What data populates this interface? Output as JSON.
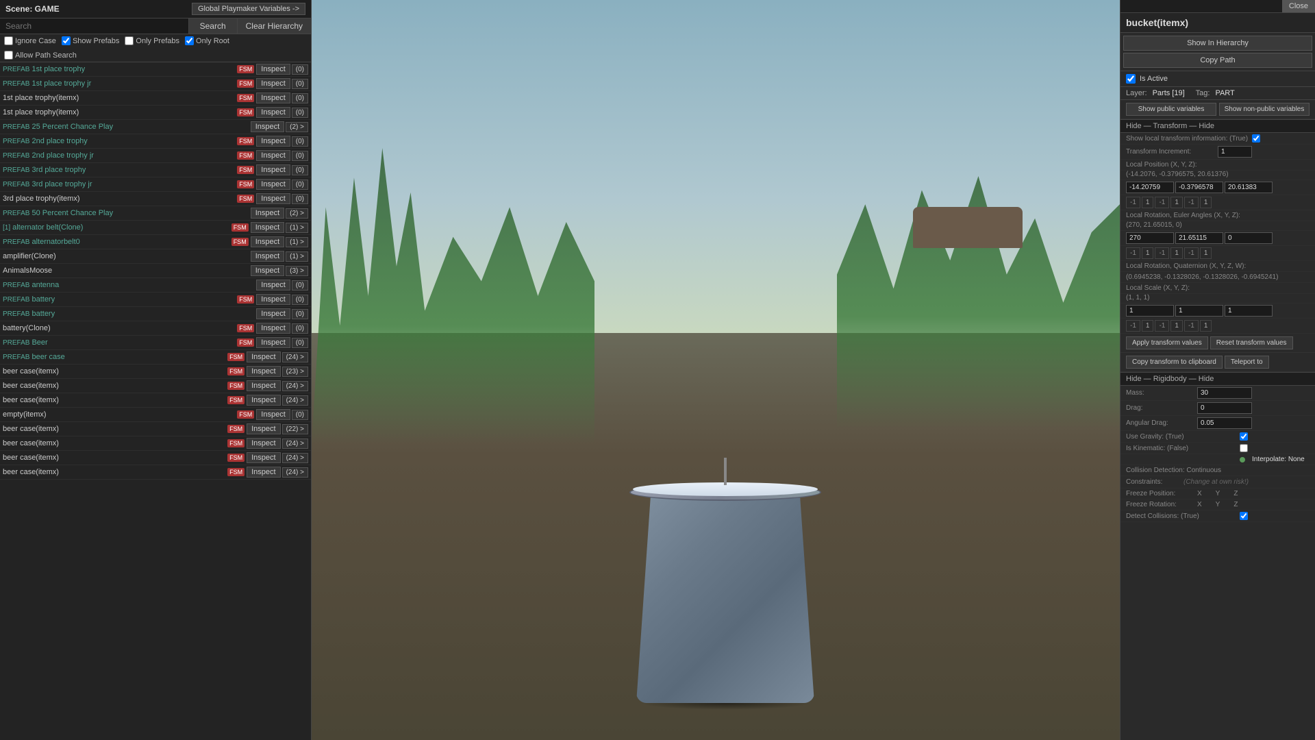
{
  "scene": {
    "title": "Scene: GAME",
    "global_playmaker_btn": "Global Playmaker Variables ->"
  },
  "search": {
    "placeholder": "Search",
    "search_label": "Search",
    "clear_label": "Clear Hierarchy"
  },
  "filters": {
    "ignore_case": "Ignore Case",
    "show_prefabs": "Show Prefabs",
    "only_prefabs": "Only Prefabs",
    "only_root": "Only Root",
    "allow_path_search": "Allow Path Search"
  },
  "hierarchy": [
    {
      "prefab": "PREFAB",
      "name": "1st place trophy",
      "fsm": true,
      "inspect": "Inspect",
      "count": "(0)"
    },
    {
      "prefab": "PREFAB",
      "name": "1st place trophy jr",
      "fsm": true,
      "inspect": "Inspect",
      "count": "(0)"
    },
    {
      "prefab": "",
      "name": "1st place trophy(itemx)",
      "fsm": true,
      "inspect": "Inspect",
      "count": "(0)"
    },
    {
      "prefab": "",
      "name": "1st place trophy(itemx)",
      "fsm": true,
      "inspect": "Inspect",
      "count": "(0)"
    },
    {
      "prefab": "PREFAB",
      "name": "25 Percent Chance Play",
      "fsm": false,
      "inspect": "Inspect",
      "count": "(2) >"
    },
    {
      "prefab": "PREFAB",
      "name": "2nd place trophy",
      "fsm": true,
      "inspect": "Inspect",
      "count": "(0)"
    },
    {
      "prefab": "PREFAB",
      "name": "2nd place trophy jr",
      "fsm": true,
      "inspect": "Inspect",
      "count": "(0)"
    },
    {
      "prefab": "PREFAB",
      "name": "3rd place trophy",
      "fsm": true,
      "inspect": "Inspect",
      "count": "(0)"
    },
    {
      "prefab": "PREFAB",
      "name": "3rd place trophy jr",
      "fsm": true,
      "inspect": "Inspect",
      "count": "(0)"
    },
    {
      "prefab": "",
      "name": "3rd place trophy(itemx)",
      "fsm": true,
      "inspect": "Inspect",
      "count": "(0)"
    },
    {
      "prefab": "PREFAB",
      "name": "50 Percent Chance Play",
      "fsm": false,
      "inspect": "Inspect",
      "count": "(2) >"
    },
    {
      "prefab": "[1]",
      "name": "alternator belt(Clone)",
      "fsm": true,
      "inspect": "Inspect",
      "count": "(1) >"
    },
    {
      "prefab": "PREFAB",
      "name": "alternatorbelt0",
      "fsm": true,
      "inspect": "Inspect",
      "count": "(1) >"
    },
    {
      "prefab": "",
      "name": "amplifier(Clone)",
      "fsm": false,
      "inspect": "Inspect",
      "count": "(1) >"
    },
    {
      "prefab": "",
      "name": "AnimalsMoose",
      "fsm": false,
      "inspect": "Inspect",
      "count": "(3) >"
    },
    {
      "prefab": "PREFAB",
      "name": "antenna",
      "fsm": false,
      "inspect": "Inspect",
      "count": "(0)"
    },
    {
      "prefab": "PREFAB",
      "name": "battery",
      "fsm": true,
      "inspect": "Inspect",
      "count": "(0)"
    },
    {
      "prefab": "PREFAB",
      "name": "battery",
      "fsm": false,
      "inspect": "Inspect",
      "count": "(0)"
    },
    {
      "prefab": "",
      "name": "battery(Clone)",
      "fsm": true,
      "inspect": "Inspect",
      "count": "(0)"
    },
    {
      "prefab": "PREFAB",
      "name": "Beer",
      "fsm": true,
      "inspect": "Inspect",
      "count": "(0)"
    },
    {
      "prefab": "PREFAB",
      "name": "beer case",
      "fsm": true,
      "inspect": "Inspect",
      "count": "(24) >"
    },
    {
      "prefab": "",
      "name": "beer case(itemx)",
      "fsm": true,
      "inspect": "Inspect",
      "count": "(23) >"
    },
    {
      "prefab": "",
      "name": "beer case(itemx)",
      "fsm": true,
      "inspect": "Inspect",
      "count": "(24) >"
    },
    {
      "prefab": "",
      "name": "beer case(itemx)",
      "fsm": true,
      "inspect": "Inspect",
      "count": "(24) >"
    },
    {
      "prefab": "",
      "name": "empty(itemx)",
      "fsm": true,
      "inspect": "Inspect",
      "count": "(0)"
    },
    {
      "prefab": "",
      "name": "beer case(itemx)",
      "fsm": true,
      "inspect": "Inspect",
      "count": "(22) >"
    },
    {
      "prefab": "",
      "name": "beer case(itemx)",
      "fsm": true,
      "inspect": "Inspect",
      "count": "(24) >"
    },
    {
      "prefab": "",
      "name": "beer case(itemx)",
      "fsm": true,
      "inspect": "Inspect",
      "count": "(24) >"
    },
    {
      "prefab": "",
      "name": "beer case(itemx)",
      "fsm": true,
      "inspect": "Inspect",
      "count": "(24) >"
    }
  ],
  "inspector": {
    "title": "bucket(itemx)",
    "show_in_hierarchy": "Show In Hierarchy",
    "copy_path": "Copy Path",
    "is_active_label": "Is Active",
    "layer_label": "Layer:",
    "layer_value": "Parts [19]",
    "tag_label": "Tag:",
    "tag_value": "PART",
    "show_public_vars": "Show public variables",
    "show_non_public_vars": "Show non-public variables",
    "hide_transform_label": "Hide — Transform — Hide",
    "show_local_transform": "Show local transform information: (True)",
    "transform_increment_label": "Transform Increment:",
    "transform_increment_val": "1",
    "local_pos_label": "Local Position (X, Y, Z):",
    "local_pos_detail": "(-14.2076, -0.3796575, 20.61376)",
    "local_pos_x": "-14.20759",
    "local_pos_y": "-0.3796578",
    "local_pos_z": "20.61383",
    "local_rot_label": "Local Rotation, Euler Angles (X, Y, Z):",
    "local_rot_detail": "(270, 21.65015, 0)",
    "local_rot_x": "270",
    "local_rot_y": "21.65115",
    "local_rot_z": "0",
    "local_rot_quat_label": "Local Rotation, Quaternion (X, Y, Z, W):",
    "local_rot_quat_detail": "(0.6945238, -0.1328026, -0.1328026, -0.6945241)",
    "local_scale_label": "Local Scale (X, Y, Z):",
    "local_scale_detail": "(1, 1, 1)",
    "local_scale_x": "1",
    "local_scale_y": "1",
    "local_scale_z": "1",
    "apply_transform": "Apply transform values",
    "reset_transform": "Reset transform values",
    "copy_transform": "Copy transform to clipboard",
    "teleport_to": "Teleport to",
    "hide_rigidbody": "Hide — Rigidbody — Hide",
    "mass_label": "Mass:",
    "mass_val": "30",
    "drag_label": "Drag:",
    "drag_val": "0",
    "angular_drag_label": "Angular Drag:",
    "angular_drag_val": "0.05",
    "use_gravity_label": "Use Gravity: (True)",
    "is_kinematic_label": "Is Kinematic: (False)",
    "interpolate_label": "Interpolate: None",
    "collision_detection_label": "Collision Detection: Continuous",
    "constraints_label": "Constraints:",
    "constraints_note": "(Change at own risk!)",
    "freeze_pos_label": "Freeze Position:",
    "freeze_rot_label": "Freeze Rotation:",
    "freeze_x": "X",
    "freeze_y": "Y",
    "freeze_z": "Z",
    "detect_collisions_label": "Detect Collisions: (True)",
    "close_label": "Close"
  },
  "colors": {
    "prefab_color": "#5a9977",
    "fsm_bg": "#993333",
    "selected_bg": "#2a4a6a",
    "accent": "#4a9aca",
    "header_bg": "#1e1e1e"
  }
}
